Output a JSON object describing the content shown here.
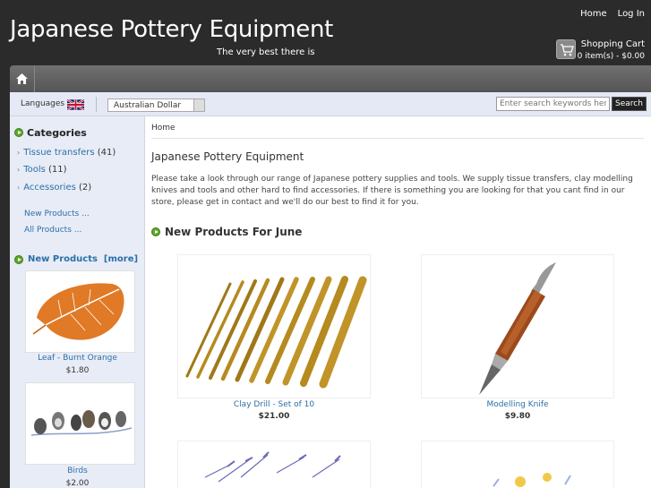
{
  "header": {
    "site_title": "Japanese Pottery Equipment",
    "tagline": "The very best there is",
    "links": [
      "Home",
      "Log In"
    ],
    "cart_title": "Shopping Cart",
    "cart_info": "0 item(s) - $0.00"
  },
  "toolbar": {
    "languages_label": "Languages",
    "currency_value": "Australian Dollar",
    "search_placeholder": "Enter search keywords here",
    "search_label": "Search"
  },
  "sidebar": {
    "categories_heading": "Categories",
    "categories": [
      {
        "name": "Tissue transfers",
        "count": "(41)"
      },
      {
        "name": "Tools",
        "count": "(11)"
      },
      {
        "name": "Accessories",
        "count": "(2)"
      }
    ],
    "links": [
      "New Products ...",
      "All Products ..."
    ],
    "new_products_heading": "New Products",
    "more_label": "[more]",
    "products": [
      {
        "name": "Leaf - Burnt Orange",
        "price": "$1.80"
      },
      {
        "name": "Birds",
        "price": "$2.00"
      }
    ]
  },
  "main": {
    "breadcrumb": "Home",
    "title": "Japanese Pottery Equipment",
    "intro": "Please take a look through our range of Japanese pottery supplies and tools. We supply tissue transfers, clay modelling knives and tools and other hard to find accessories. If there is something you are looking for that you cant find in our store, please get in contact and we'll do our best to find it for you.",
    "section_title": "New Products For June",
    "products": [
      {
        "name": "Clay Drill - Set of 10",
        "price": "$21.00"
      },
      {
        "name": "Modelling Knife",
        "price": "$9.80"
      }
    ]
  },
  "colors": {
    "header_bg": "#2b2b2b",
    "link": "#2b6fa8",
    "accent_green": "#5fa62a",
    "sidebar_bg": "#e8ecf6"
  }
}
